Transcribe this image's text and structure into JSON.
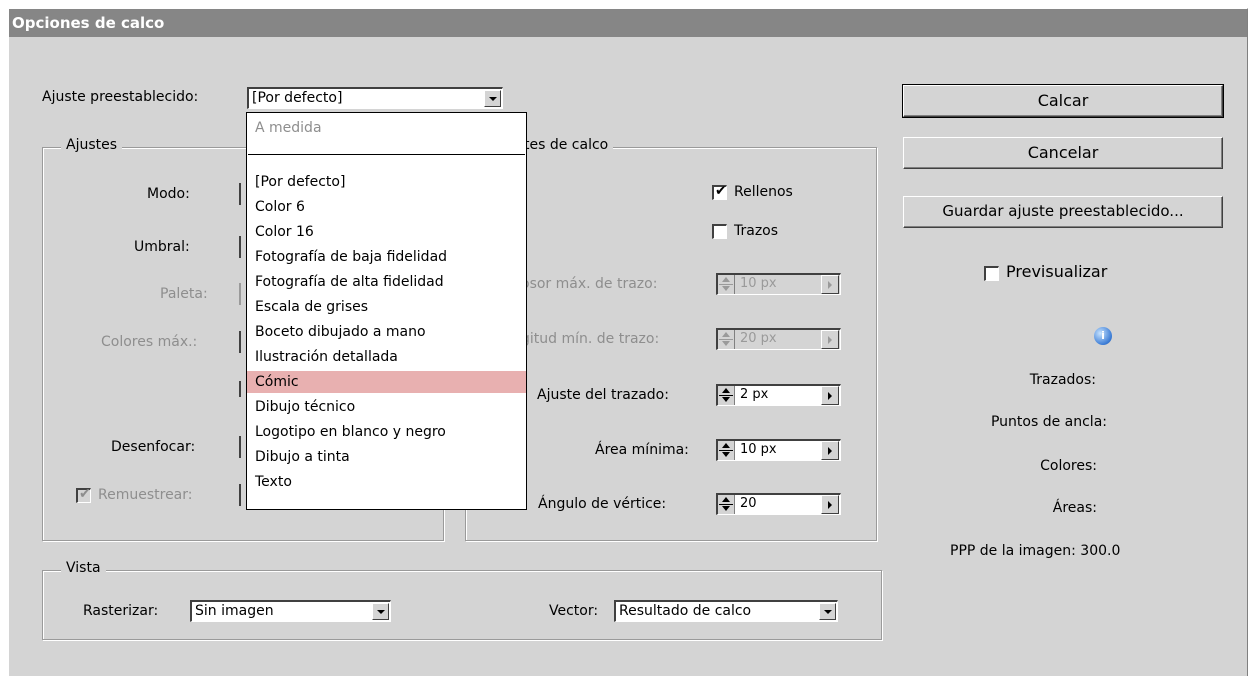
{
  "window": {
    "title": "Opciones de calco"
  },
  "preset": {
    "label": "Ajuste preestablecido:",
    "value": "[Por defecto]"
  },
  "preset_menu": {
    "custom": "A medida",
    "items": [
      "[Por defecto]",
      "Color 6",
      "Color 16",
      "Fotografía de baja fidelidad",
      "Fotografía de alta fidelidad",
      "Escala de grises",
      "Boceto dibujado a mano",
      "Ilustración detallada",
      "Cómic",
      "Dibujo técnico",
      "Logotipo en blanco y negro",
      "Dibujo a tinta",
      "Texto"
    ],
    "highlighted": "Cómic"
  },
  "settings_group": {
    "legend": "Ajustes",
    "mode_label": "Modo:",
    "threshold_label": "Umbral:",
    "palette_label": "Paleta:",
    "max_colors_label": "Colores máx.:",
    "blur_label": "Desenfocar:",
    "resample_label": "Remuestrear:",
    "resample_checked": true
  },
  "trace_group": {
    "legend": "tes de calco",
    "fills_label": "Rellenos",
    "fills_checked": true,
    "strokes_label": "Trazos",
    "strokes_checked": false,
    "max_stroke_label": "osor máx. de trazo:",
    "max_stroke_value": "10 px",
    "min_stroke_label": "gitud mín. de trazo:",
    "min_stroke_value": "20 px",
    "path_fit_label": "Ajuste del trazado:",
    "path_fit_value": "2 px",
    "min_area_label": "Área mínima:",
    "min_area_value": "10 px",
    "corner_angle_label": "Ángulo de vértice:",
    "corner_angle_value": "20"
  },
  "view_group": {
    "legend": "Vista",
    "raster_label": "Rasterizar:",
    "raster_value": "Sin imagen",
    "vector_label": "Vector:",
    "vector_value": "Resultado de calco"
  },
  "buttons": {
    "trace": "Calcar",
    "cancel": "Cancelar",
    "save_preset": "Guardar ajuste preestablecido..."
  },
  "preview": {
    "label": "Previsualizar",
    "checked": false
  },
  "info": {
    "icon": "info-icon",
    "paths_label": "Trazados:",
    "anchors_label": "Puntos de ancla:",
    "colors_label": "Colores:",
    "areas_label": "Áreas:",
    "ppi_label": "PPP de la imagen:",
    "ppi_value": "300.0"
  }
}
